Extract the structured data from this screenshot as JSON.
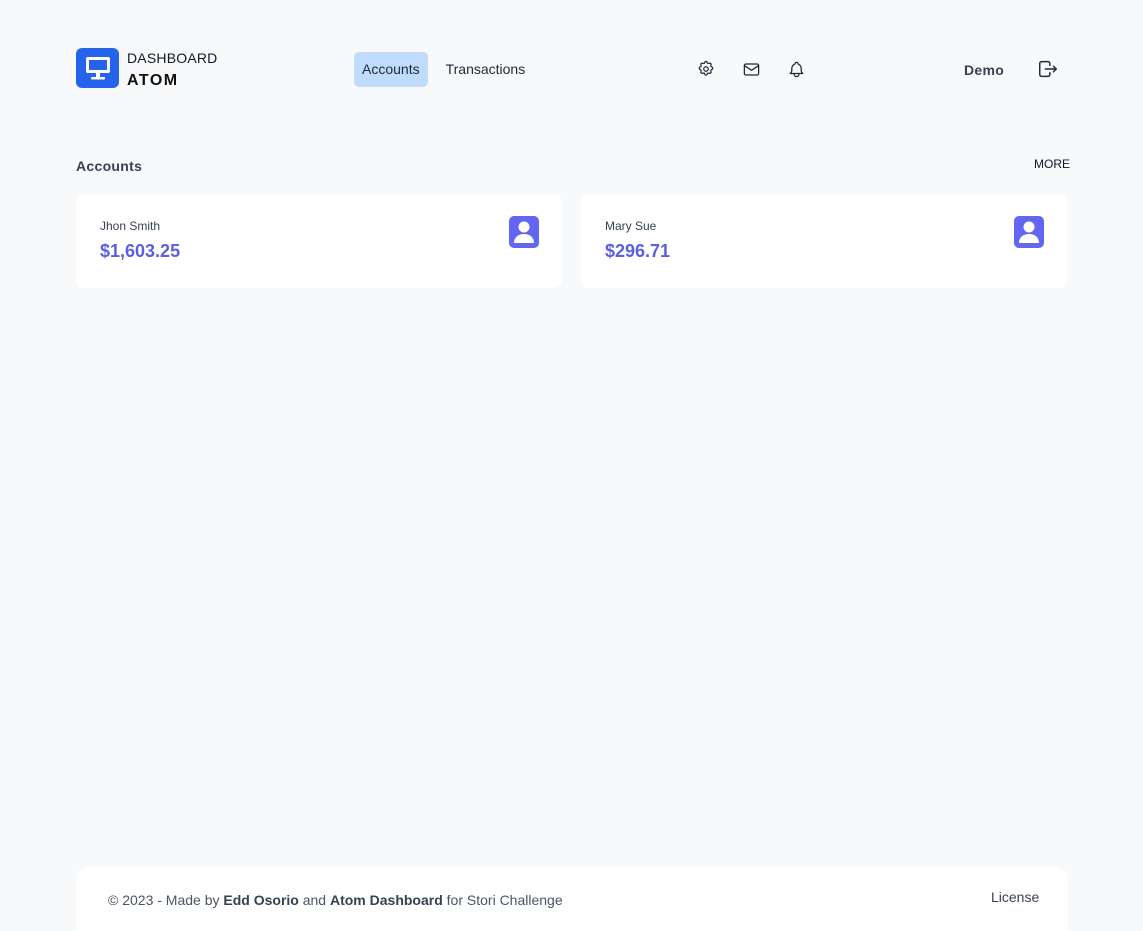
{
  "brand": {
    "subtitle": "DASHBOARD",
    "title": "ATOM",
    "color": "#2563eb"
  },
  "nav": {
    "items": [
      {
        "label": "Accounts",
        "active": true
      },
      {
        "label": "Transactions",
        "active": false
      }
    ]
  },
  "header_icons": [
    "gear-icon",
    "mail-icon",
    "bell-icon"
  ],
  "user": {
    "name": "Demo"
  },
  "accounts": {
    "title": "Accounts",
    "more_label": "MORE",
    "items": [
      {
        "name": "Jhon Smith",
        "balance": "$1,603.25"
      },
      {
        "name": "Mary Sue",
        "balance": "$296.71"
      }
    ]
  },
  "footer": {
    "prefix": "© 2023 - Made by",
    "author": "Edd Osorio",
    "and": "and",
    "project": "Atom Dashboard",
    "suffix": "for Stori Challenge",
    "license": "License"
  },
  "colors": {
    "accent": "#5b5fe0",
    "active_nav": "#bfdbfe",
    "background": "#f8f9fb"
  }
}
